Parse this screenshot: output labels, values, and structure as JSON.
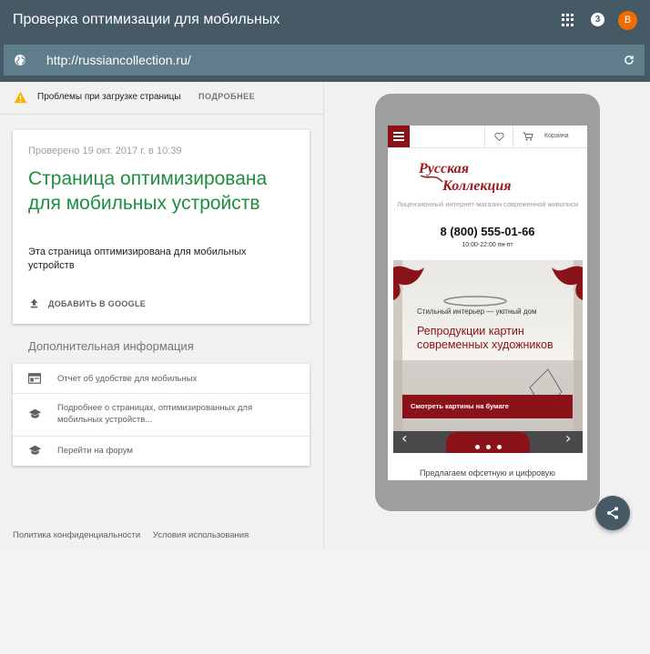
{
  "header": {
    "title": "Проверка оптимизации для мобильных",
    "notification_count": "3",
    "avatar_letter": "В"
  },
  "urlbar": {
    "value": "http://russiancollection.ru/"
  },
  "warning": {
    "text": "Проблемы при загрузке страницы",
    "link": "ПОДРОБНЕЕ"
  },
  "result": {
    "checked": "Проверено 19 окт. 2017 г. в 10:39",
    "title": "Страница оптимизирована для мобильных устройств",
    "description": "Эта страница оптимизирована для мобильных устройств",
    "add_label": "ДОБАВИТЬ В GOOGLE"
  },
  "more_info": {
    "heading": "Дополнительная информация",
    "items": [
      {
        "label": "Отчет об удобстве для мобильных",
        "icon": "report-icon"
      },
      {
        "label": "Подробнее о страницах, оптимизированных для мобильных устройств...",
        "icon": "school-icon"
      },
      {
        "label": "Перейти на форум",
        "icon": "school-icon"
      }
    ]
  },
  "footer": {
    "privacy": "Политика конфиденциальности",
    "terms": "Условия использования"
  },
  "preview": {
    "cart": "Корзина",
    "logo_line1": "Русская",
    "logo_line2": "Коллекция",
    "tagline": "Лицензионный интернет-магазин современной живописи",
    "phone": "8 (800) 555-01-66",
    "hours": "10:00-22:00 пн-пт",
    "banner_sub": "Стильный интерьер — уютный дом",
    "banner_title": "Репродукции картин современных художников",
    "banner_button": "Смотреть картины на бумаге",
    "offer": "Предлагаем офсетную и цифровую"
  },
  "colors": {
    "appbar": "#455a64",
    "success_green": "#1e8e3e",
    "brand_red": "#8c1219",
    "avatar": "#ef6c00"
  }
}
